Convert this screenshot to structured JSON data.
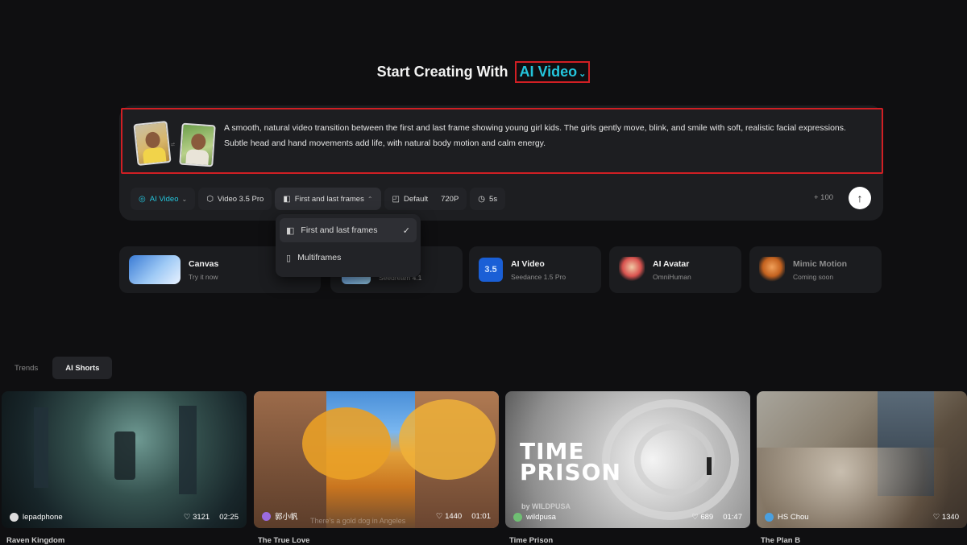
{
  "header": {
    "title_prefix": "Start Creating With",
    "title_highlight": "AI Video",
    "chevron": "⌄"
  },
  "prompt": {
    "text": "A smooth, natural video transition between the first and last frame showing young girl kids. The girls gently move, blink, and smile with soft, realistic facial expressions. Subtle head and hand movements add life, with natural body motion and calm energy.",
    "swap_glyph": "⇄"
  },
  "toolbar": {
    "mode": "AI Video",
    "model": "Video 3.5 Pro",
    "frames": "First and last frames",
    "ratio": "Default",
    "resolution": "720P",
    "duration": "5s",
    "credits": "+ 100",
    "send": "↑"
  },
  "dropdown": {
    "items": [
      {
        "label": "First and last frames",
        "selected": true
      },
      {
        "label": "Multiframes",
        "selected": false
      }
    ],
    "check": "✓"
  },
  "feature_cards": [
    {
      "title": "Canvas",
      "subtitle": "Try it now"
    },
    {
      "title": "",
      "subtitle": "Seedream 4.1"
    },
    {
      "title": "AI Video",
      "subtitle": "Seedance 1.5 Pro",
      "badge": "3.5"
    },
    {
      "title": "AI Avatar",
      "subtitle": "OmniHuman"
    },
    {
      "title": "Mimic Motion",
      "subtitle": "Coming soon"
    }
  ],
  "tabs": [
    "Trends",
    "AI Shorts"
  ],
  "videos": [
    {
      "author": "lepadphone",
      "likes": "3121",
      "duration": "02:25",
      "title": "Raven Kingdom"
    },
    {
      "author": "郭小帆",
      "likes": "1440",
      "duration": "01:01",
      "title": "The True Love",
      "caption": "There's a gold dog in Angeles"
    },
    {
      "author": "wildpusa",
      "likes": "689",
      "duration": "01:47",
      "title": "Time Prison",
      "overlay": "TIME\nPRISON",
      "watermark": "by WILDPUSA"
    },
    {
      "author": "HS Chou",
      "likes": "1340",
      "title": "The Plan B"
    }
  ],
  "colors": {
    "accent": "#24c5dc",
    "highlight_border": "#d11f24",
    "panel": "#1d1e21"
  }
}
